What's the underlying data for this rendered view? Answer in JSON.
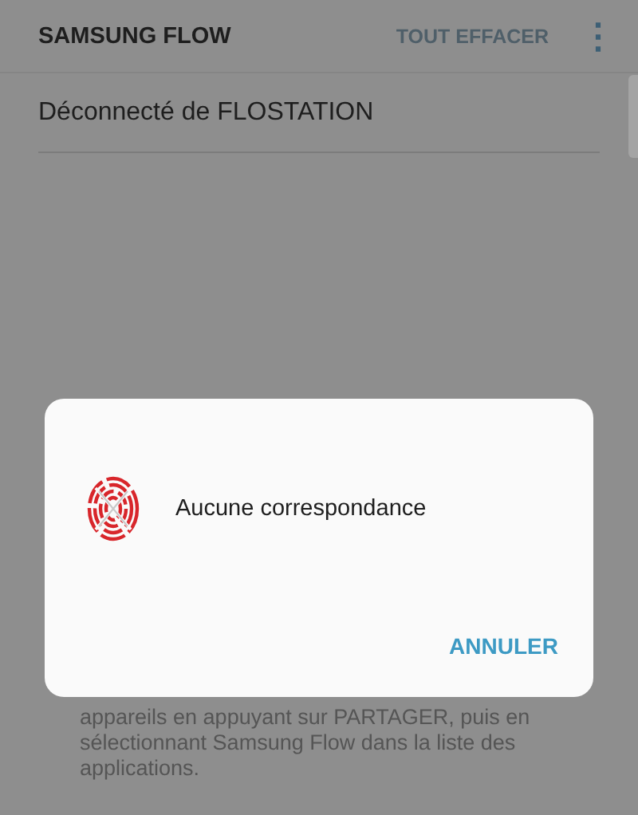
{
  "app_bar": {
    "title": "SAMSUNG FLOW",
    "action": "TOUT EFFACER",
    "menu": "⋮"
  },
  "messages": [
    {
      "text": "Déconnecté de FLOSTATION"
    }
  ],
  "background_text": "appareils en appuyant sur PARTAGER, puis en sélectionnant Samsung Flow dans la liste des applications.",
  "dialog": {
    "message": "Aucune correspondance",
    "buttons": [
      "ANNULER"
    ]
  }
}
